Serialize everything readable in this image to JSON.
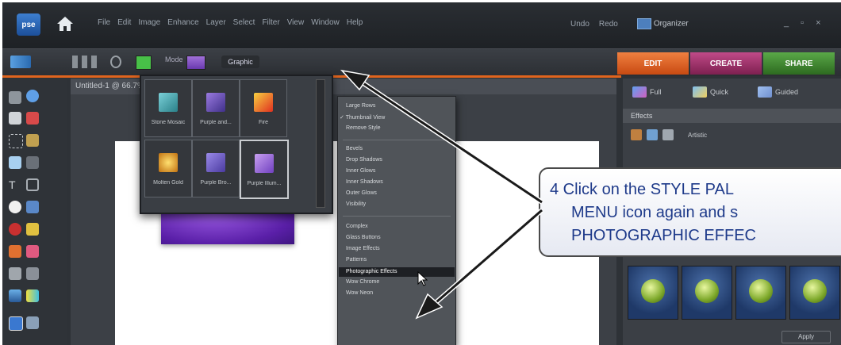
{
  "app": {
    "logo_text": "pse"
  },
  "menubar": {
    "items": [
      "File",
      "Edit",
      "Image",
      "Enhance",
      "Layer",
      "Select",
      "Filter",
      "View",
      "Window",
      "Help"
    ],
    "undo": "Undo",
    "redo": "Redo",
    "organizer": "Organizer"
  },
  "options_bar": {
    "mode_label": "Mode",
    "graphic_button": "Graphic"
  },
  "tabs": [
    {
      "label": "EDIT",
      "color": "#e2642a"
    },
    {
      "label": "CREATE",
      "color": "#a0336c"
    },
    {
      "label": "SHARE",
      "color": "#3d8a2e"
    }
  ],
  "document": {
    "tab_label": "Untitled-1 @ 66.7%"
  },
  "style_picker": {
    "items": [
      {
        "label": "Stone Mosaic",
        "color": "#4aa0a8"
      },
      {
        "label": "Purple and...",
        "color": "#6f4fc0"
      },
      {
        "label": "Fire",
        "color": "#e04a28"
      },
      {
        "label": "Molten Gold",
        "color": "#e0a020"
      },
      {
        "label": "Purple Bro...",
        "color": "#6a59c8"
      },
      {
        "label": "Purple Illum...",
        "color": "#9a6ad6"
      }
    ]
  },
  "context_menu": {
    "items": [
      {
        "label": "Large Rows",
        "checked": false,
        "group": 1
      },
      {
        "label": "Thumbnail View",
        "checked": true,
        "group": 1
      },
      {
        "label": "Remove Style",
        "checked": false,
        "group": 1
      },
      {
        "label": "Bevels",
        "group": 2
      },
      {
        "label": "Drop Shadows",
        "group": 2
      },
      {
        "label": "Inner Glows",
        "group": 2
      },
      {
        "label": "Inner Shadows",
        "group": 2
      },
      {
        "label": "Outer Glows",
        "group": 2
      },
      {
        "label": "Visibility",
        "group": 2
      },
      {
        "label": "Complex",
        "group": 3
      },
      {
        "label": "Glass Buttons",
        "group": 3
      },
      {
        "label": "Image Effects",
        "group": 3
      },
      {
        "label": "Patterns",
        "group": 3
      },
      {
        "label": "Photographic Effects",
        "group": 3,
        "highlighted": true
      },
      {
        "label": "Wow Chrome",
        "group": 3
      },
      {
        "label": "Wow Neon",
        "group": 3
      }
    ]
  },
  "panel": {
    "buttons": [
      "Full",
      "Quick",
      "Guided"
    ],
    "effects_header": "Effects",
    "filter_label": "Artistic",
    "apply_button": "Apply"
  },
  "callout": {
    "line1": "4  Click on the STYLE PAL",
    "line2": "MENU icon again and s",
    "line3": "PHOTOGRAPHIC EFFEC"
  }
}
